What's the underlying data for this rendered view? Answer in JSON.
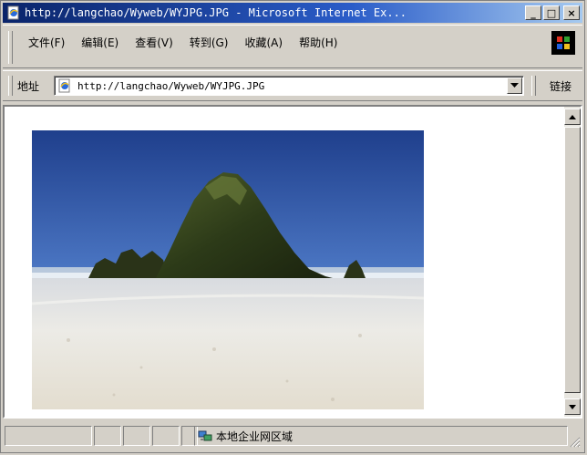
{
  "window": {
    "title": "http://langchao/Wyweb/WYJPG.JPG - Microsoft Internet Ex...",
    "caption_buttons": {
      "minimize": "_",
      "maximize": "□",
      "close": "×"
    }
  },
  "menu": {
    "items": [
      {
        "label": "文件(F)"
      },
      {
        "label": "编辑(E)"
      },
      {
        "label": "查看(V)"
      },
      {
        "label": "转到(G)"
      },
      {
        "label": "收藏(A)"
      },
      {
        "label": "帮助(H)"
      }
    ]
  },
  "address_bar": {
    "label": "地址",
    "url": "http://langchao/Wyweb/WYJPG.JPG",
    "links_label": "链接"
  },
  "status_bar": {
    "zone_text": "本地企业网区域"
  },
  "icons": {
    "title": "ie-page-icon",
    "brand": "windows-logo-icon",
    "address": "ie-page-icon",
    "zone": "local-intranet-icon"
  },
  "colors": {
    "titlebar_start": "#0a246a",
    "titlebar_end": "#a6caf0",
    "chrome": "#d4d0c8"
  }
}
